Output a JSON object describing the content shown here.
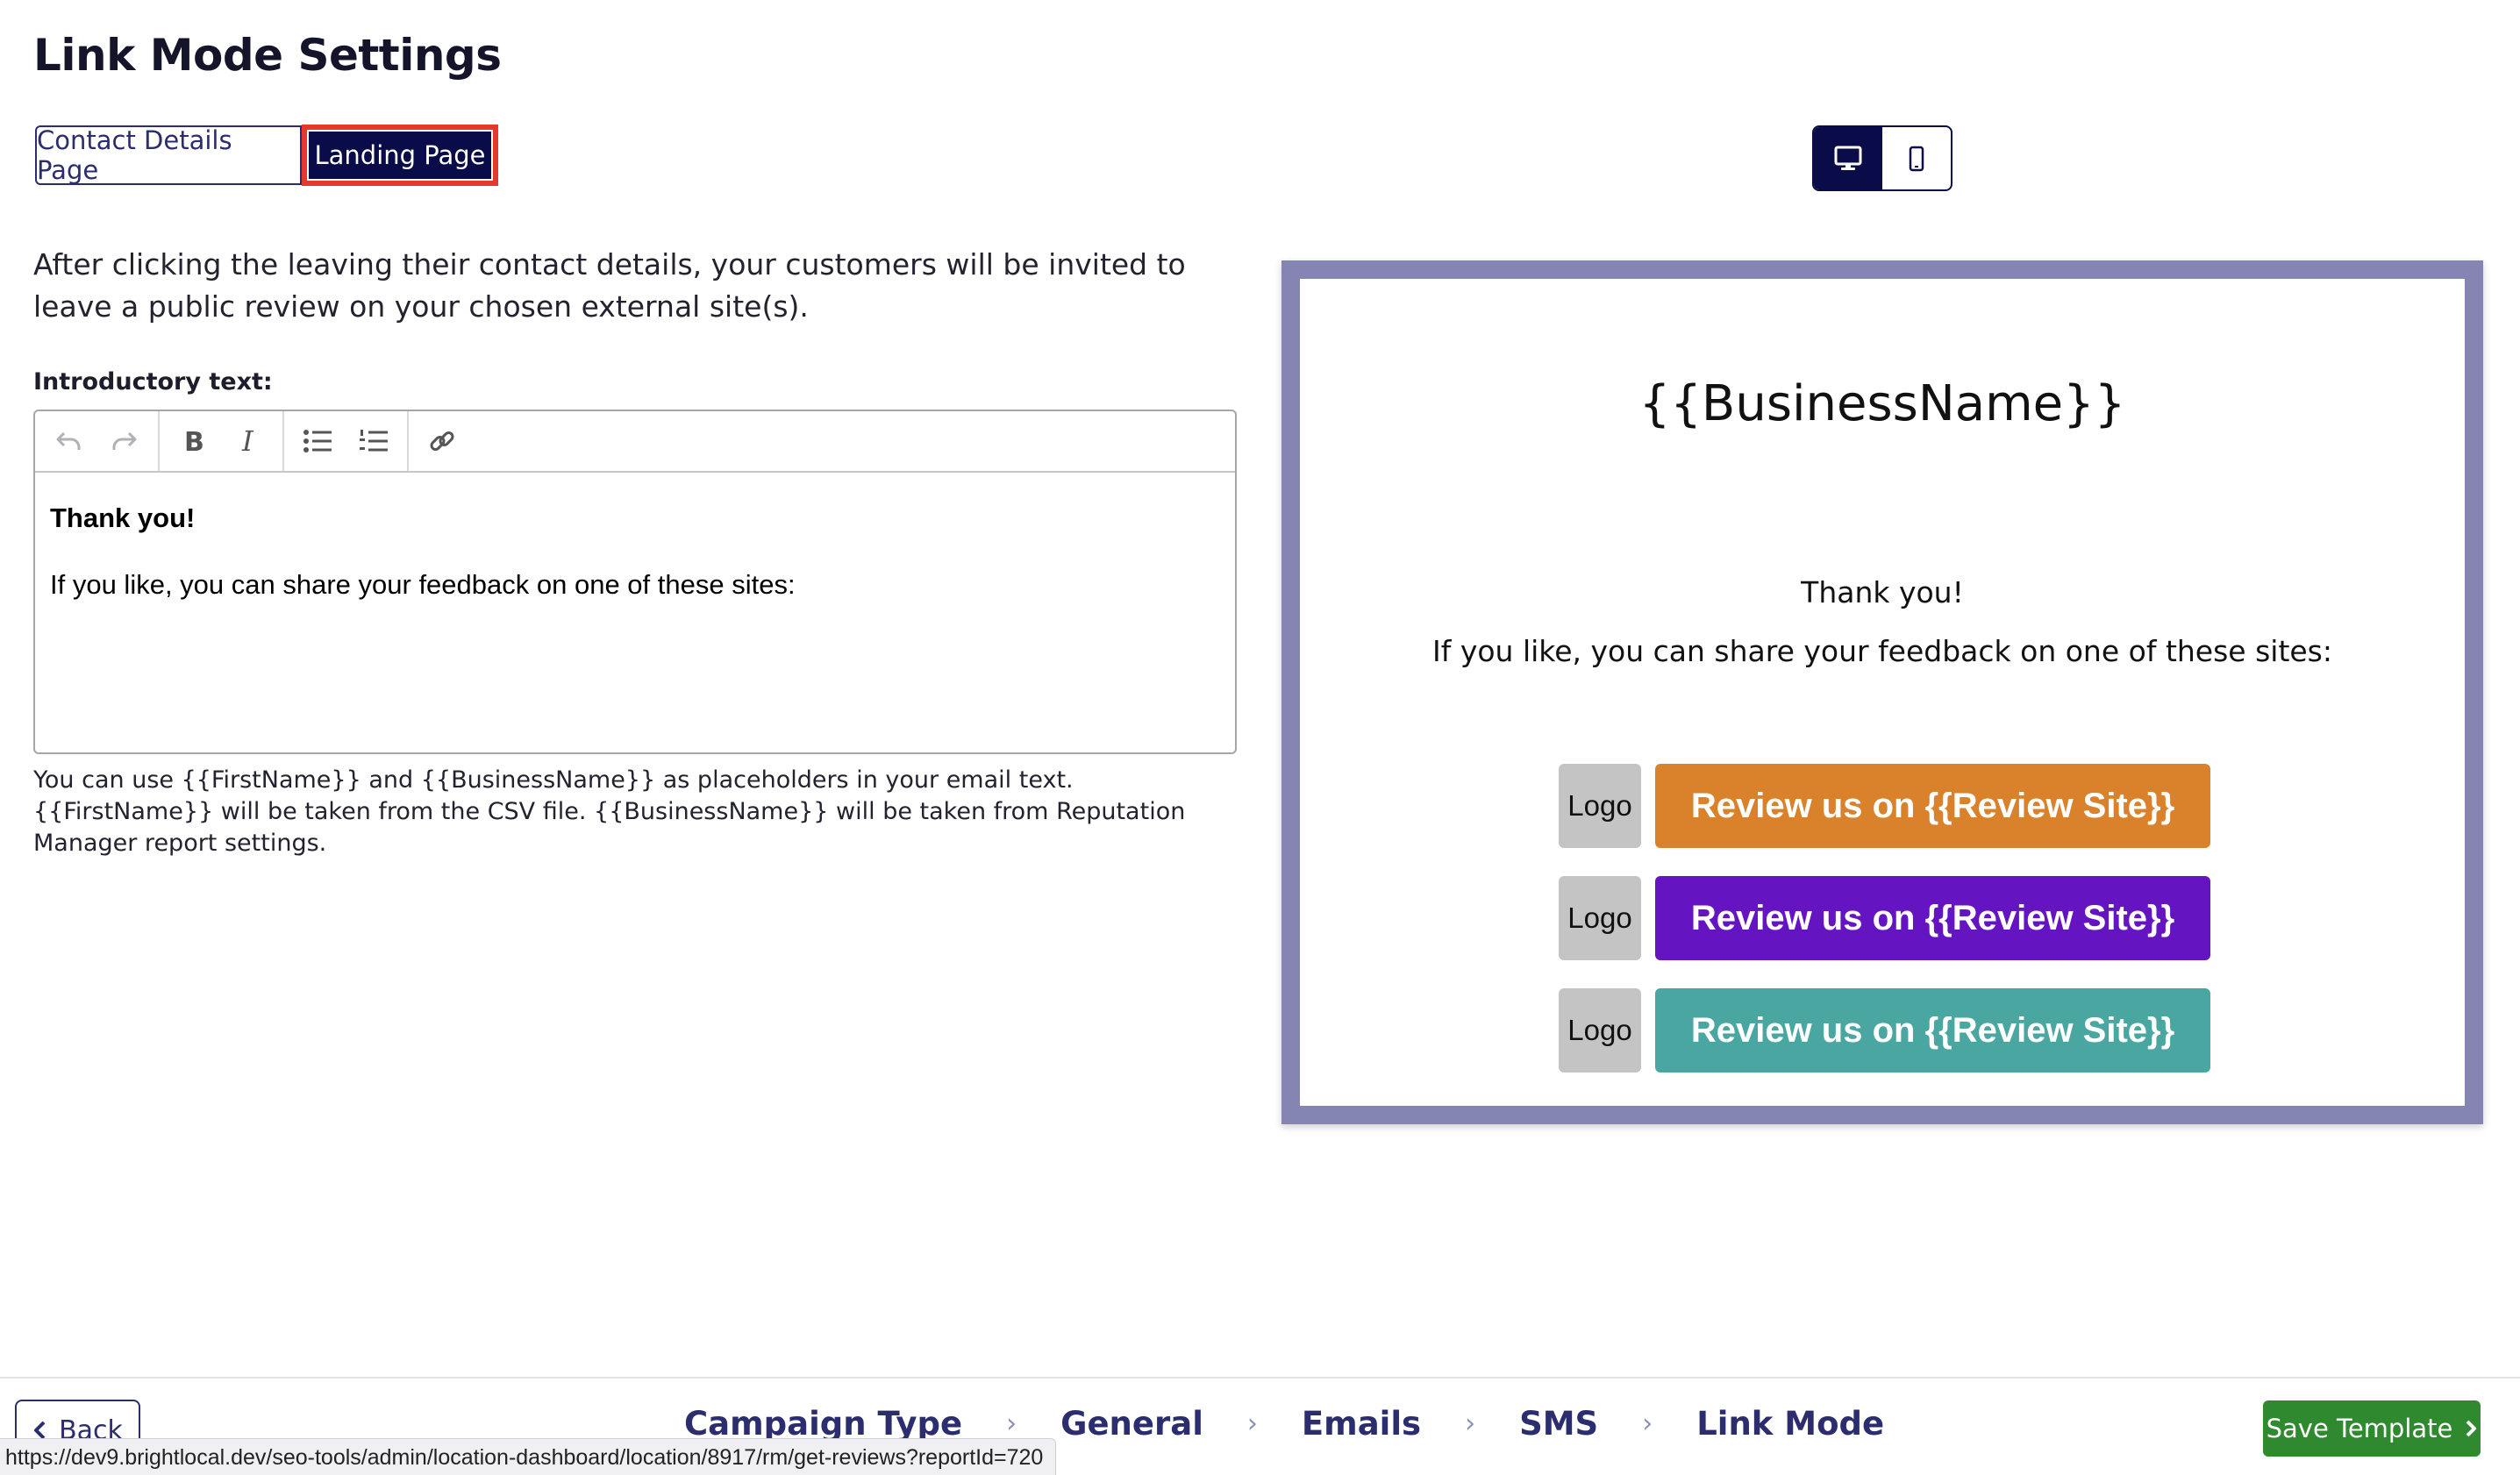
{
  "page": {
    "title": "Link Mode Settings"
  },
  "tabs": [
    {
      "label": "Contact Details Page",
      "active": false
    },
    {
      "label": "Landing Page",
      "active": true
    }
  ],
  "device_toggle": {
    "desktop_icon": "desktop-icon",
    "mobile_icon": "mobile-icon",
    "active": "desktop"
  },
  "intro_text": "After clicking the leaving their contact details, your customers will be invited to leave a public review on your chosen external site(s).",
  "editor": {
    "label": "Introductory text:",
    "toolbar_icons": [
      "undo-icon",
      "redo-icon",
      "bold-icon",
      "italic-icon",
      "bulleted-list-icon",
      "numbered-list-icon",
      "link-icon"
    ],
    "content_line1": "Thank you!",
    "content_line2": "If you like, you can share your feedback on one of these sites:"
  },
  "help_text": "You can use {{FirstName}} and {{BusinessName}} as placeholders in your email text. {{FirstName}} will be taken from the CSV file. {{BusinessName}} will be taken from Reputation Manager report settings.",
  "preview": {
    "business_name": "{{BusinessName}}",
    "thanks": "Thank you!",
    "share": "If you like, you can share your feedback on one of these sites:",
    "reviews": [
      {
        "logo": "Logo",
        "label": "Review us on {{Review Site}}",
        "color": "#d9822b"
      },
      {
        "logo": "Logo",
        "label": "Review us on {{Review Site}}",
        "color": "#6514c2"
      },
      {
        "logo": "Logo",
        "label": "Review us on {{Review Site}}",
        "color": "#4aa6a0"
      }
    ]
  },
  "footer": {
    "back_label": "Back",
    "steps": [
      "Campaign Type",
      "General",
      "Emails",
      "SMS",
      "Link Mode"
    ],
    "save_label": "Save Template"
  },
  "status_url": "https://dev9.brightlocal.dev/seo-tools/admin/location-dashboard/location/8917/rm/get-reviews?reportId=720",
  "colors": {
    "primary": "#0a0c4a",
    "highlight": "#e6392d",
    "preview_border": "#8485b3",
    "save_green": "#2f8a2f"
  }
}
